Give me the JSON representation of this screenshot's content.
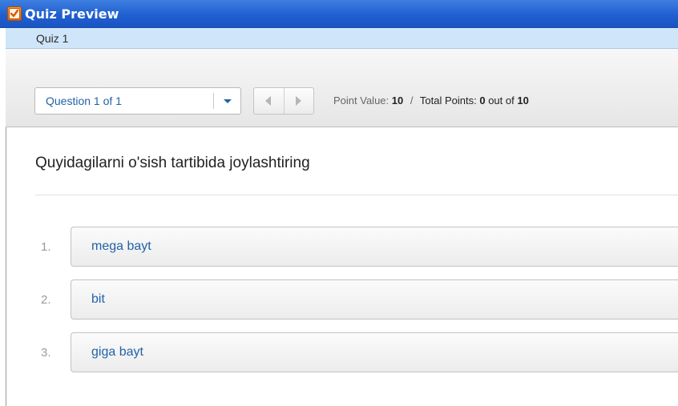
{
  "window": {
    "title": "Quiz Preview",
    "icon": "quiz-app-icon",
    "accent_color": "#1f5fd0"
  },
  "quiz": {
    "name": "Quiz 1"
  },
  "toolbar": {
    "question_select": {
      "selected": "Question 1 of 1"
    },
    "points": {
      "point_value_label": "Point Value:",
      "point_value": "10",
      "separator": "/",
      "total_points_label": "Total Points:",
      "total_points": "0",
      "out_of_label": "out of",
      "out_of": "10"
    }
  },
  "question": {
    "text": "Quyidagilarni o'sish tartibida joylashtiring",
    "answers": [
      {
        "number": "1.",
        "label": "mega bayt"
      },
      {
        "number": "2.",
        "label": "bit"
      },
      {
        "number": "3.",
        "label": "giga bayt"
      }
    ]
  }
}
